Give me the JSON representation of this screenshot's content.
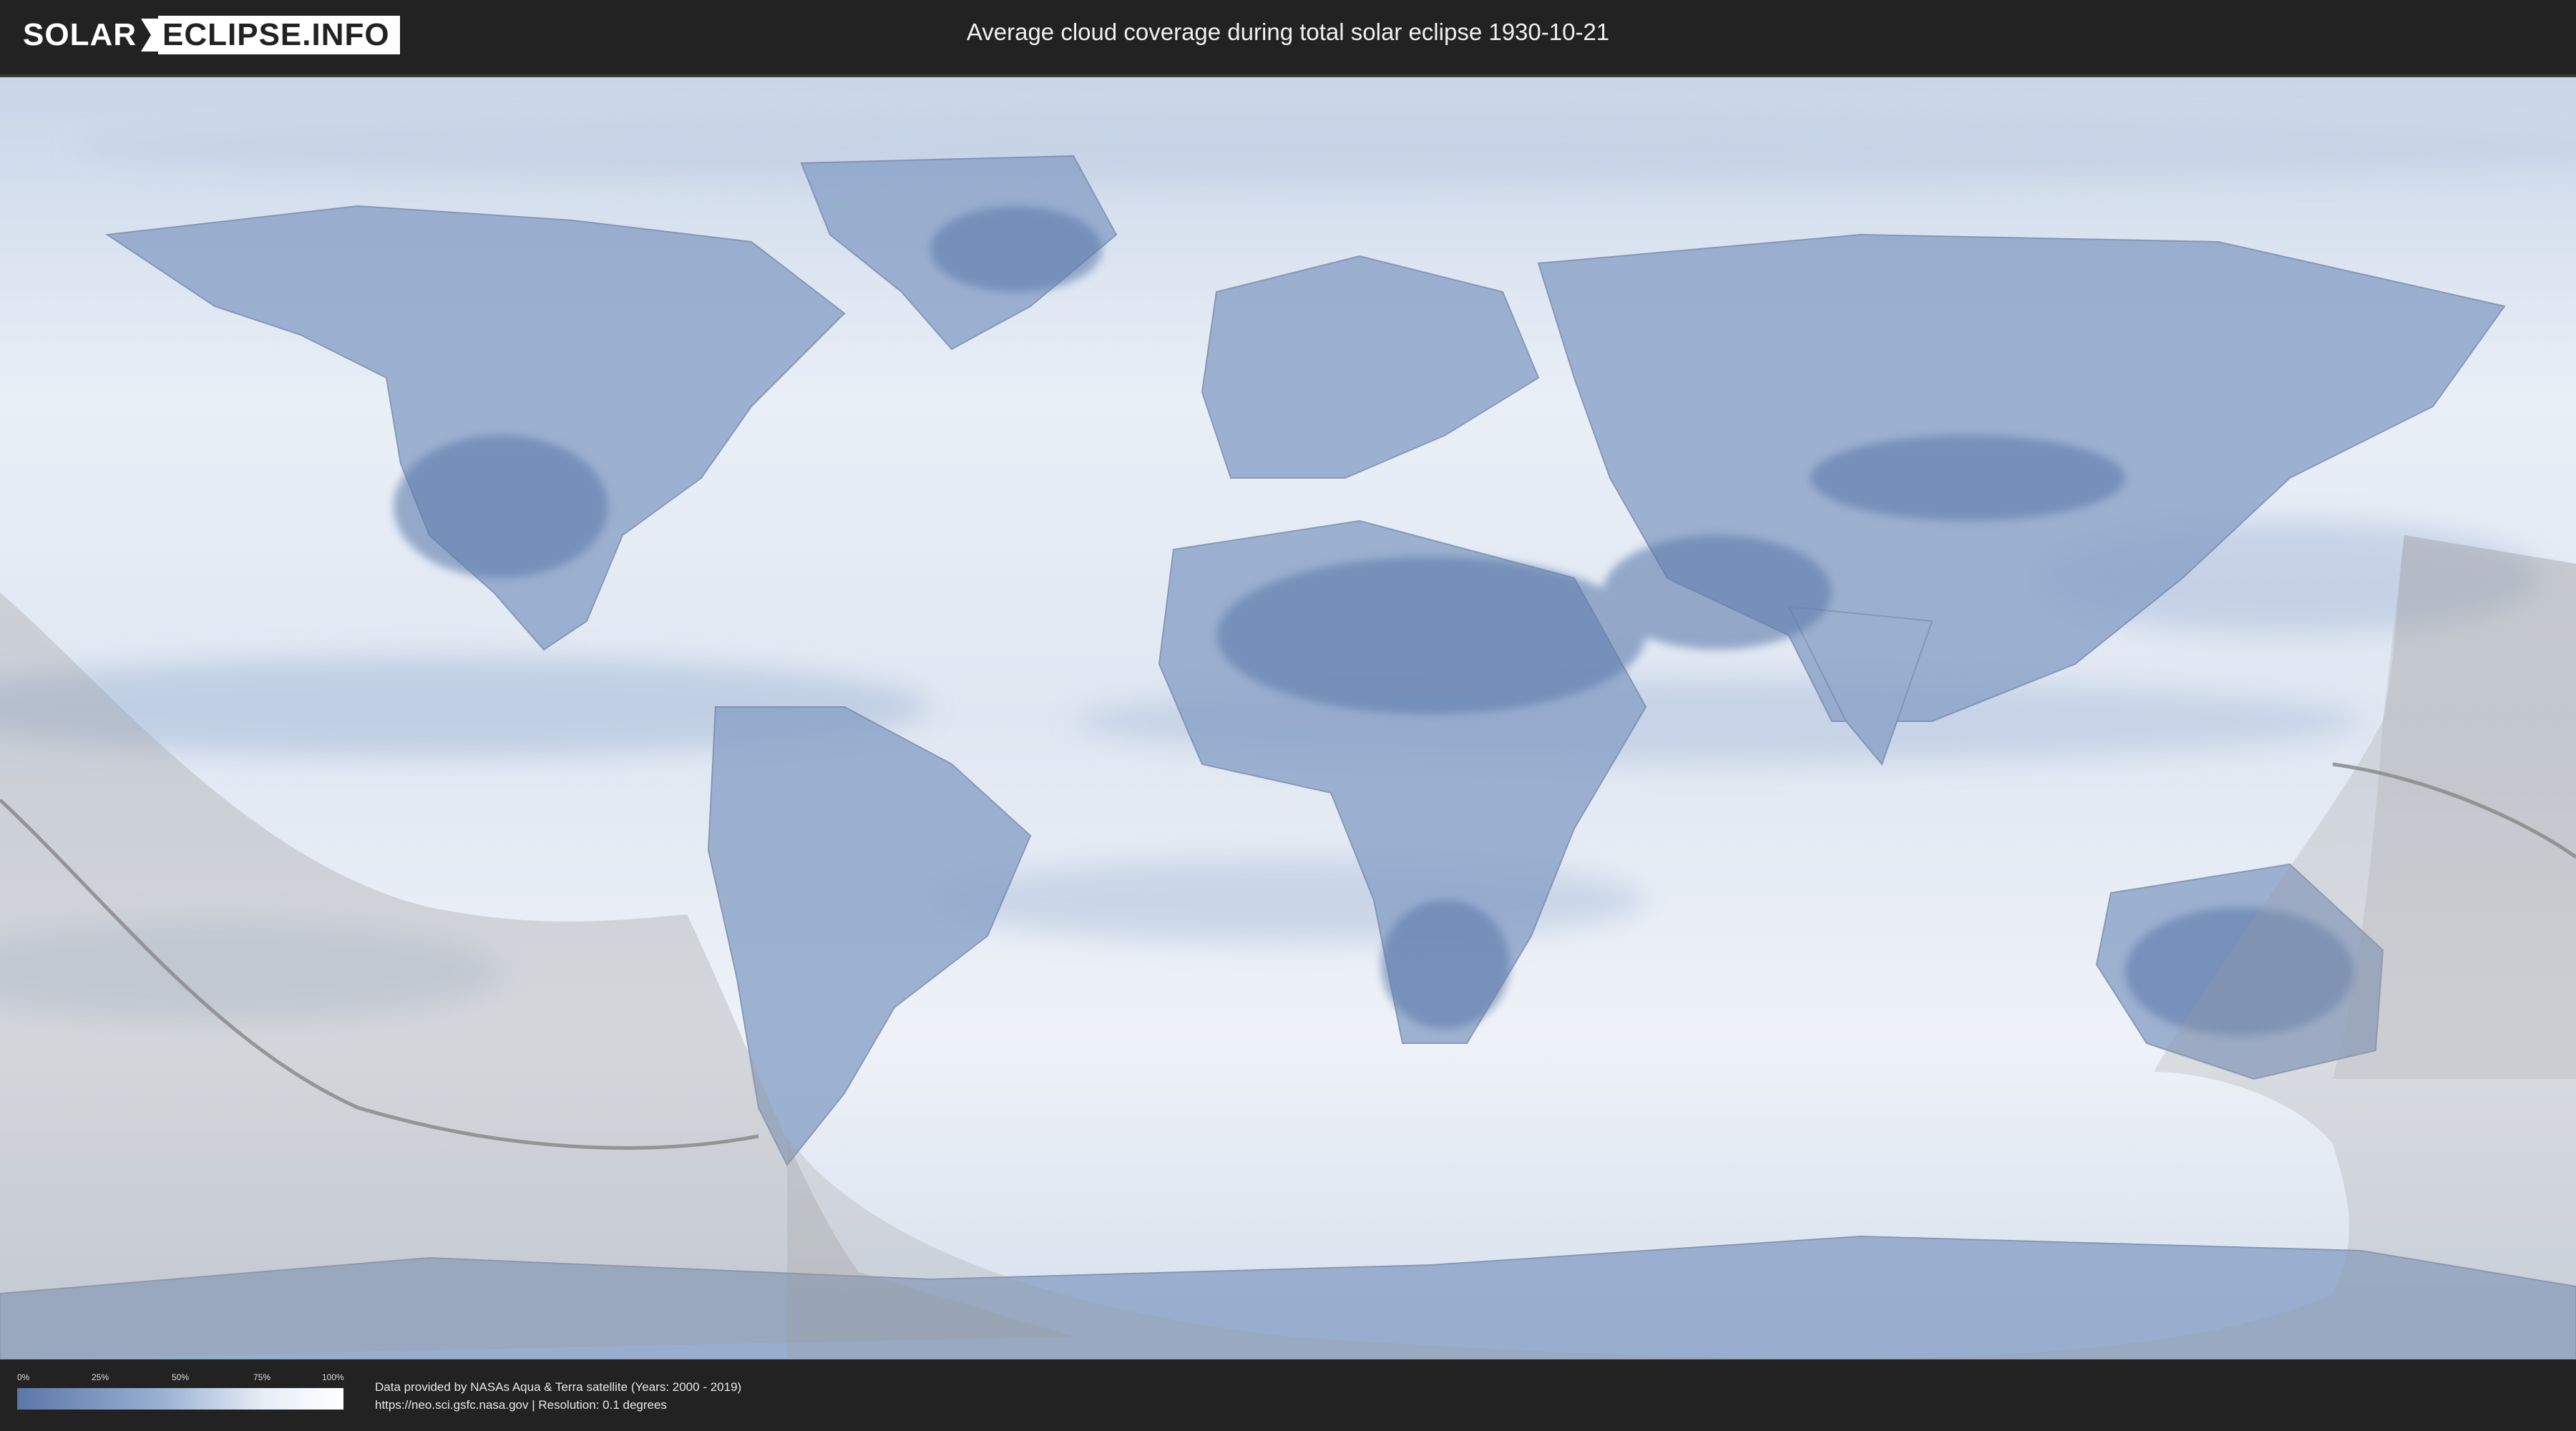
{
  "header": {
    "logo_left": "SOLAR",
    "logo_right": "ECLIPSE.INFO",
    "title": "Average cloud coverage during total solar eclipse 1930-10-21"
  },
  "legend": {
    "ticks": [
      "0%",
      "25%",
      "50%",
      "75%",
      "100%"
    ],
    "colors": {
      "low": "#5b77a8",
      "high": "#ffffff"
    }
  },
  "credits": {
    "line1": "Data provided by NASAs Aqua & Terra satellite (Years: 2000 - 2019)",
    "line2": "https://neo.sci.gsfc.nasa.gov | Resolution: 0.1 degrees"
  },
  "map": {
    "palette": {
      "ocean_clear": "#e8eef6",
      "cloud_low": "#7d96bf",
      "land_clear": "#6d88b6",
      "shadow": "#9a9a9a",
      "path_line": "#8a8a8a"
    }
  }
}
